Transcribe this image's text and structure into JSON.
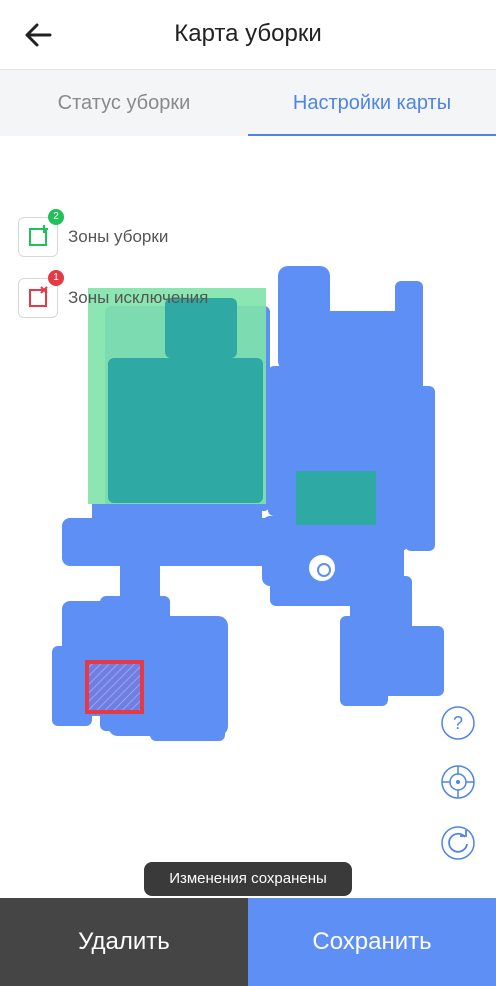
{
  "header": {
    "title": "Карта уборки",
    "back_icon": "arrow-left-icon"
  },
  "tabs": [
    {
      "label": "Статус уборки",
      "active": false
    },
    {
      "label": "Настройки карты",
      "active": true
    }
  ],
  "zones": {
    "cleaning": {
      "label": "Зоны уборки",
      "count": "2",
      "icon": "add-zone-icon",
      "badge_color": "#22c05a"
    },
    "exclusion": {
      "label": "Зоны исключения",
      "count": "1",
      "icon": "no-go-zone-icon",
      "badge_color": "#e53945"
    }
  },
  "side_buttons": [
    "help-icon",
    "locate-icon",
    "refresh-icon"
  ],
  "toast": "Изменения сохранены",
  "actions": {
    "delete_label": "Удалить",
    "save_label": "Сохранить"
  },
  "colors": {
    "accent": "#4f84e6",
    "map_floor": "#5e8ff5",
    "cleaning_zone": "#7fe3a8",
    "cleaned_overlap": "#2fa9a3",
    "exclusion_zone": "#e53945",
    "save_button": "#5e8ff5",
    "delete_button": "#454545"
  }
}
